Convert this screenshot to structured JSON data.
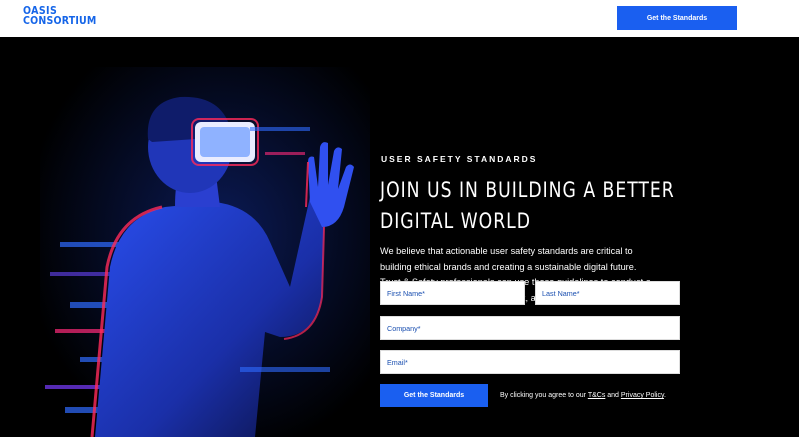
{
  "header": {
    "logo_line1": "OASIS",
    "logo_line2": "CONSORTIUM",
    "cta_label": "Get the Standards"
  },
  "hero": {
    "eyebrow": "USER SAFETY STANDARDS",
    "headline_line1": "JOIN US IN BUILDING A BETTER",
    "headline_line2": "DIGITAL WORLD",
    "body_line1": "We believe that actionable user safety standards are critical to",
    "body_line2": "building ethical brands and creating a sustainable digital future.",
    "body_line3": "Trust & Safety professionals can use these guidelines to conduct a",
    "body_line4": "self-assessment, validate their work, and secure needed resources."
  },
  "form": {
    "first_name_placeholder": "First Name*",
    "last_name_placeholder": "Last Name*",
    "company_placeholder": "Company*",
    "email_placeholder": "Email*",
    "submit_label": "Get the Standards",
    "consent_prefix": "By clicking you agree to our ",
    "tcs_link": "T&Cs",
    "consent_and": " and ",
    "privacy_link": "Privacy Policy",
    "consent_suffix": "."
  },
  "colors": {
    "brand_blue": "#1a5ff0",
    "background": "#000000",
    "header_bg": "#ffffff"
  }
}
